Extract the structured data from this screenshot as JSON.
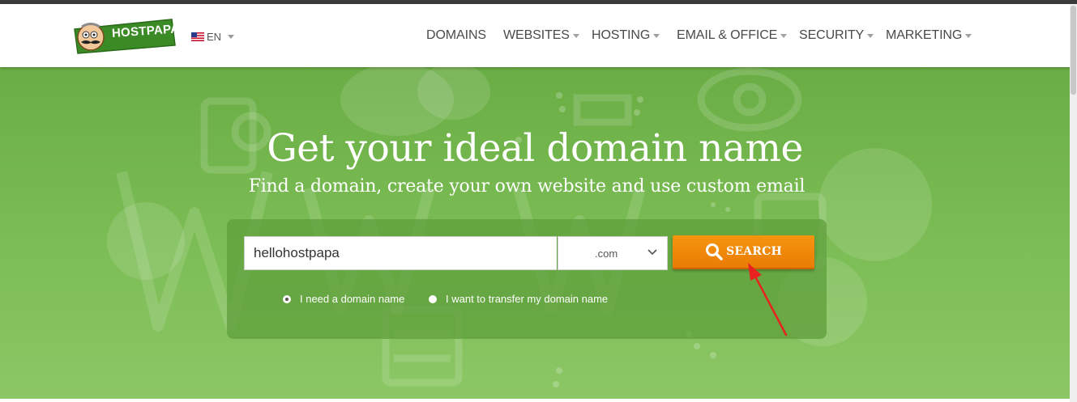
{
  "header": {
    "logo": {
      "text": "HOSTPAPA"
    },
    "language": {
      "label": "EN",
      "flag": "us-flag-icon"
    },
    "nav": [
      {
        "label": "DOMAINS",
        "has_dropdown": false
      },
      {
        "label": "WEBSITES",
        "has_dropdown": true
      },
      {
        "label": "HOSTING",
        "has_dropdown": true
      },
      {
        "label": "EMAIL & OFFICE",
        "has_dropdown": true
      },
      {
        "label": "SECURITY",
        "has_dropdown": true
      },
      {
        "label": "MARKETING",
        "has_dropdown": true
      }
    ]
  },
  "hero": {
    "title": "Get your ideal domain name",
    "subtitle": "Find a domain, create your own website and use custom email",
    "search": {
      "input_value": "hellohostpapa",
      "tld_selected": ".com",
      "button_label": "SEARCH",
      "button_icon": "search-icon"
    },
    "options": [
      {
        "label": "I need a domain name",
        "checked": true
      },
      {
        "label": "I want to transfer my domain name",
        "checked": false
      }
    ]
  },
  "colors": {
    "hero_green": "#79bb52",
    "panel_green": "#60a03c",
    "search_orange": "#f08a0a",
    "annotation_red": "#e8231f",
    "nav_text": "#4a4a4a"
  }
}
